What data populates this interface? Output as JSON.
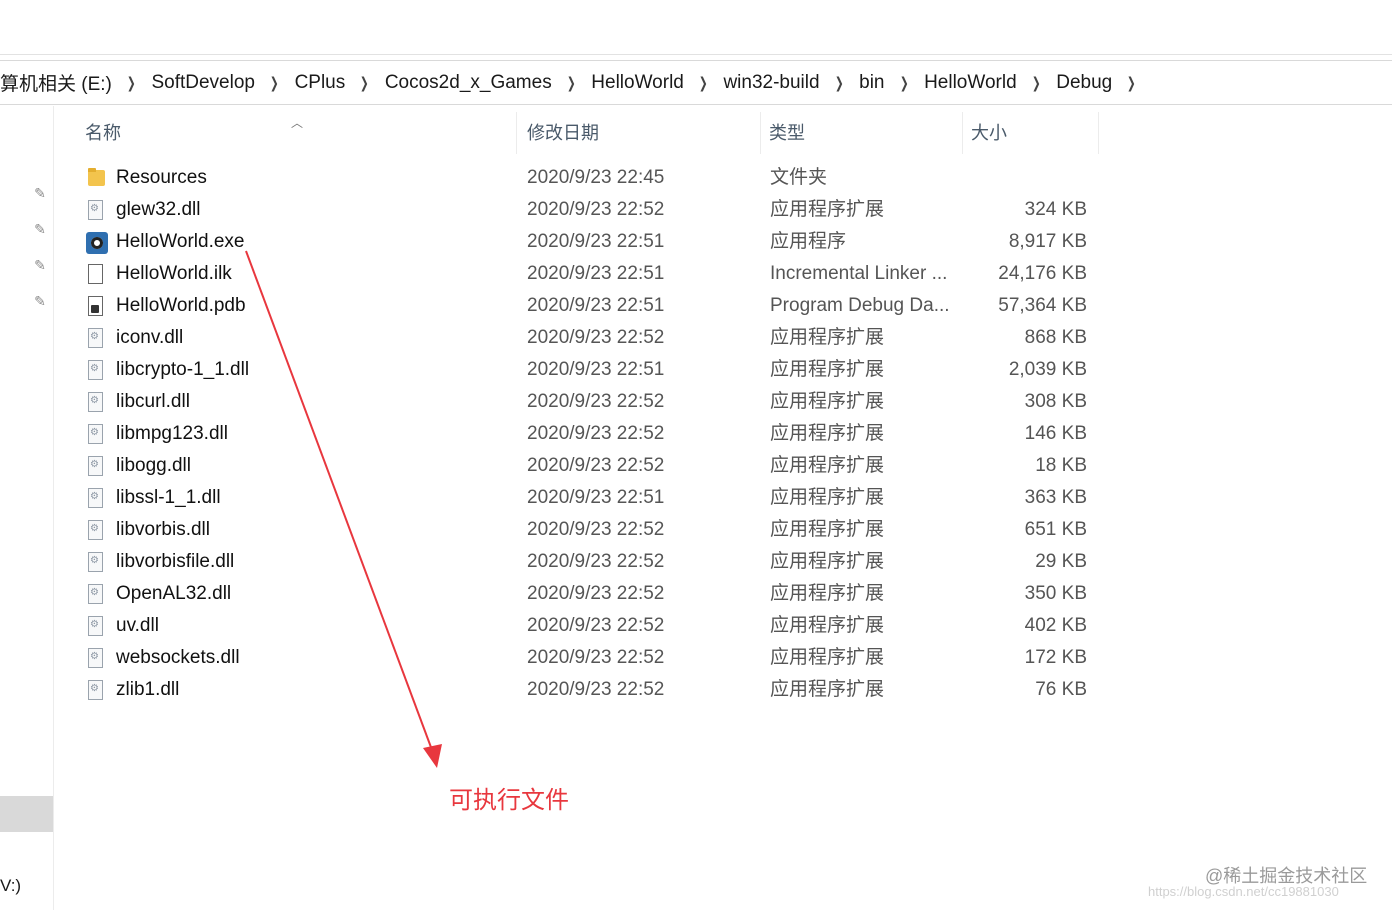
{
  "breadcrumb": [
    "算机相关 (E:)",
    "SoftDevelop",
    "CPlus",
    "Cocos2d_x_Games",
    "HelloWorld",
    "win32-build",
    "bin",
    "HelloWorld",
    "Debug"
  ],
  "columns": {
    "name": "名称",
    "date": "修改日期",
    "type": "类型",
    "size": "大小"
  },
  "files": [
    {
      "name": "Resources",
      "date": "2020/9/23 22:45",
      "type": "文件夹",
      "size": "",
      "icon": "folder-icon"
    },
    {
      "name": "glew32.dll",
      "date": "2020/9/23 22:52",
      "type": "应用程序扩展",
      "size": "324 KB",
      "icon": "dll-file-icon"
    },
    {
      "name": "HelloWorld.exe",
      "date": "2020/9/23 22:51",
      "type": "应用程序",
      "size": "8,917 KB",
      "icon": "exe-app-icon"
    },
    {
      "name": "HelloWorld.ilk",
      "date": "2020/9/23 22:51",
      "type": "Incremental Linker ...",
      "size": "24,176 KB",
      "icon": "ilk-file-icon"
    },
    {
      "name": "HelloWorld.pdb",
      "date": "2020/9/23 22:51",
      "type": "Program Debug Da...",
      "size": "57,364 KB",
      "icon": "pdb-file-icon"
    },
    {
      "name": "iconv.dll",
      "date": "2020/9/23 22:52",
      "type": "应用程序扩展",
      "size": "868 KB",
      "icon": "dll-file-icon"
    },
    {
      "name": "libcrypto-1_1.dll",
      "date": "2020/9/23 22:51",
      "type": "应用程序扩展",
      "size": "2,039 KB",
      "icon": "dll-file-icon"
    },
    {
      "name": "libcurl.dll",
      "date": "2020/9/23 22:52",
      "type": "应用程序扩展",
      "size": "308 KB",
      "icon": "dll-file-icon"
    },
    {
      "name": "libmpg123.dll",
      "date": "2020/9/23 22:52",
      "type": "应用程序扩展",
      "size": "146 KB",
      "icon": "dll-file-icon"
    },
    {
      "name": "libogg.dll",
      "date": "2020/9/23 22:52",
      "type": "应用程序扩展",
      "size": "18 KB",
      "icon": "dll-file-icon"
    },
    {
      "name": "libssl-1_1.dll",
      "date": "2020/9/23 22:51",
      "type": "应用程序扩展",
      "size": "363 KB",
      "icon": "dll-file-icon"
    },
    {
      "name": "libvorbis.dll",
      "date": "2020/9/23 22:52",
      "type": "应用程序扩展",
      "size": "651 KB",
      "icon": "dll-file-icon"
    },
    {
      "name": "libvorbisfile.dll",
      "date": "2020/9/23 22:52",
      "type": "应用程序扩展",
      "size": "29 KB",
      "icon": "dll-file-icon"
    },
    {
      "name": "OpenAL32.dll",
      "date": "2020/9/23 22:52",
      "type": "应用程序扩展",
      "size": "350 KB",
      "icon": "dll-file-icon"
    },
    {
      "name": "uv.dll",
      "date": "2020/9/23 22:52",
      "type": "应用程序扩展",
      "size": "402 KB",
      "icon": "dll-file-icon"
    },
    {
      "name": "websockets.dll",
      "date": "2020/9/23 22:52",
      "type": "应用程序扩展",
      "size": "172 KB",
      "icon": "dll-file-icon"
    },
    {
      "name": "zlib1.dll",
      "date": "2020/9/23 22:52",
      "type": "应用程序扩展",
      "size": "76 KB",
      "icon": "dll-file-icon"
    }
  ],
  "nav": {
    "bottom_label": "V:)"
  },
  "annotation": {
    "text": "可执行文件",
    "color": "#e8373e"
  },
  "watermark": {
    "text": "@稀土掘金技术社区",
    "url_text": "https://blog.csdn.net/cc19881030"
  }
}
